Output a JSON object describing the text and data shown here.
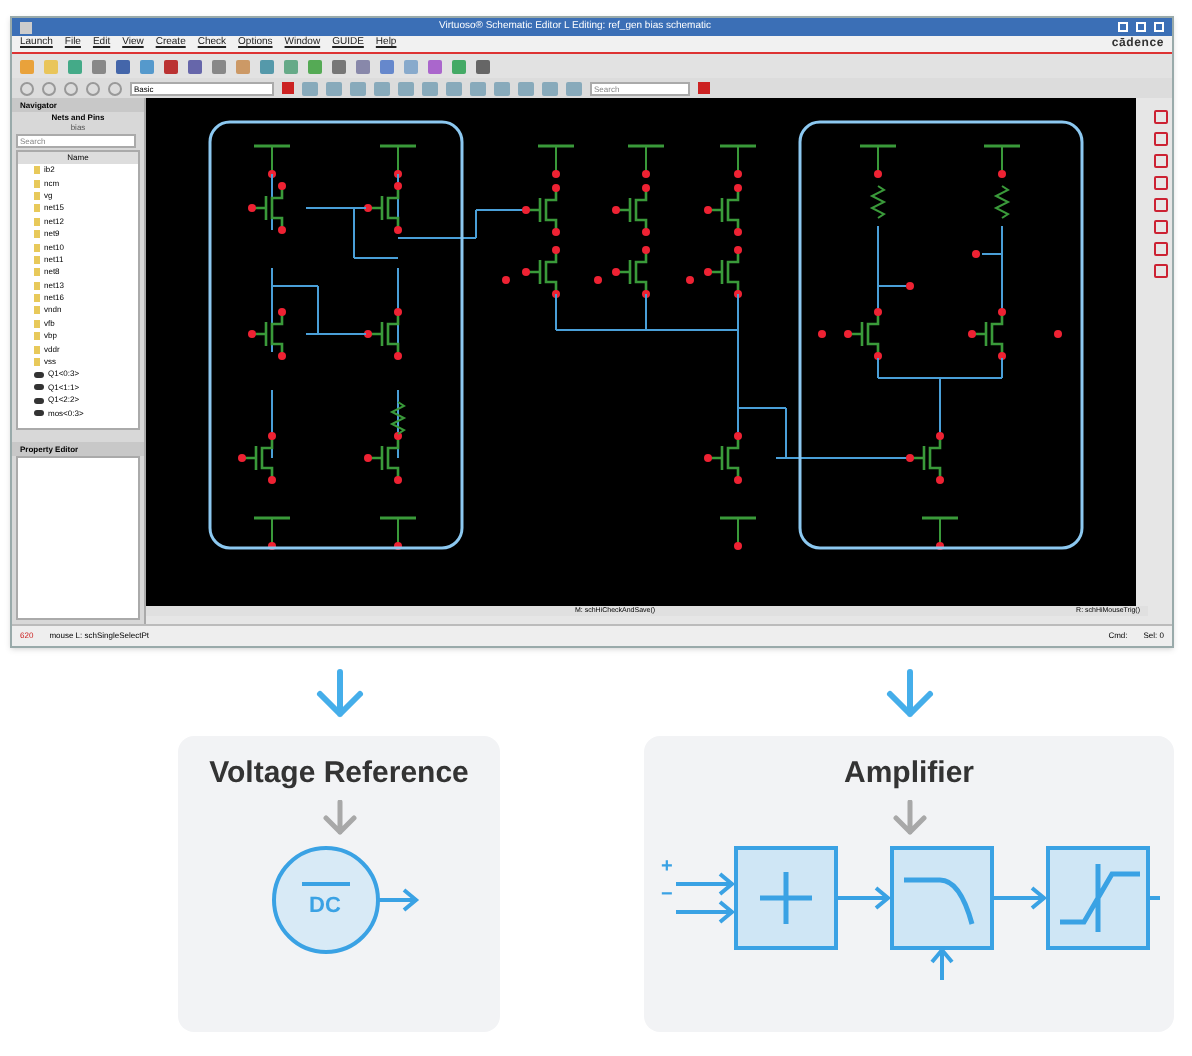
{
  "window": {
    "title": "Virtuoso® Schematic Editor L Editing: ref_gen bias schematic",
    "brand": "cādence"
  },
  "menu": [
    "Launch",
    "File",
    "Edit",
    "View",
    "Create",
    "Check",
    "Options",
    "Window",
    "GUIDE",
    "Help"
  ],
  "toolbar": {
    "view_field": "Basic",
    "search_placeholder": "Search"
  },
  "navigator": {
    "title": "Navigator",
    "heading": "Nets and Pins",
    "subheading": "bias",
    "search_placeholder": "Search",
    "column": "Name",
    "items": [
      {
        "label": "ib2",
        "kind": "net"
      },
      {
        "label": "ncm",
        "kind": "net"
      },
      {
        "label": "vg",
        "kind": "net"
      },
      {
        "label": "net15",
        "kind": "net"
      },
      {
        "label": "net12",
        "kind": "net"
      },
      {
        "label": "net9",
        "kind": "net"
      },
      {
        "label": "net10",
        "kind": "net"
      },
      {
        "label": "net11",
        "kind": "net"
      },
      {
        "label": "net8",
        "kind": "net"
      },
      {
        "label": "net13",
        "kind": "net"
      },
      {
        "label": "net16",
        "kind": "net"
      },
      {
        "label": "vndn",
        "kind": "net"
      },
      {
        "label": "vfb",
        "kind": "net"
      },
      {
        "label": "vbp",
        "kind": "net"
      },
      {
        "label": "vddr",
        "kind": "net"
      },
      {
        "label": "vss",
        "kind": "net"
      },
      {
        "label": "Q1<0:3>",
        "kind": "instance"
      },
      {
        "label": "Q1<1:1>",
        "kind": "instance"
      },
      {
        "label": "Q1<2:2>",
        "kind": "instance"
      },
      {
        "label": "mos<0:3>",
        "kind": "instance"
      }
    ]
  },
  "property_editor": {
    "title": "Property Editor"
  },
  "status": {
    "left": "M: schHiCheckAndSave()",
    "right": "R: schHiMouseTrig()",
    "prompt": "mouse L: schSingleSelectPt",
    "cmd": "Cmd:",
    "sel": "Sel: 0",
    "line": "620"
  },
  "blocks": [
    {
      "title": "Voltage Reference",
      "kind": "reference",
      "symbol": "DC"
    },
    {
      "title": "Amplifier",
      "kind": "amplifier",
      "inputs": [
        "+",
        "−"
      ]
    }
  ]
}
